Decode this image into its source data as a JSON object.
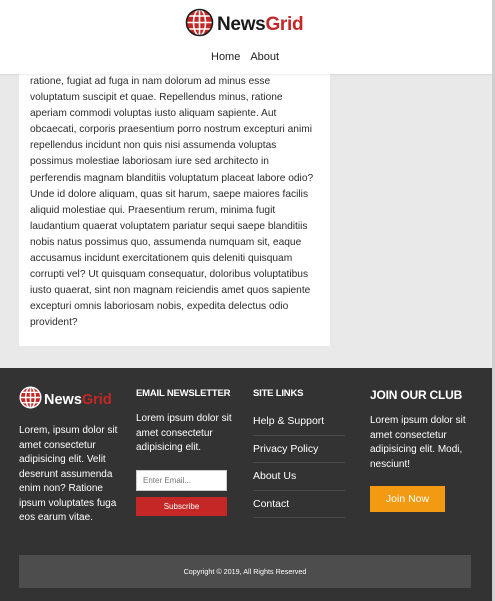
{
  "header": {
    "brand": {
      "part1": "News",
      "part2": "Grid",
      "logo_icon": "globe-icon"
    },
    "nav": [
      {
        "label": "Home"
      },
      {
        "label": "About"
      }
    ]
  },
  "article": {
    "body": "ratione, fugiat ad fuga in nam dolorum ad minus esse voluptatum suscipit et quae. Repellendus minus, ratione aperiam commodi voluptas iusto aliquam sapiente. Aut obcaecati, corporis praesentium porro nostrum excepturi animi repellendus incidunt non quis nisi assumenda voluptas possimus molestiae laboriosam iure sed architecto in perferendis magnam blanditiis voluptatum placeat labore odio? Unde id dolore aliquam, quas sit harum, saepe maiores facilis aliquid molestiae qui. Praesentium rerum, minima fugit laudantium quaerat voluptatem pariatur sequi saepe blanditiis nobis natus possimus quo, assumenda numquam sit, eaque accusamus incidunt exercitationem quis deleniti quisquam corrupti vel? Ut quisquam consequatur, doloribus voluptatibus iusto quaerat, sint non magnam reiciendis amet quos sapiente excepturi omnis laboriosam nobis, expedita delectus odio provident?"
  },
  "footer": {
    "about": {
      "brand_part1": "News",
      "brand_part2": "Grid",
      "text": "Lorem, ipsum dolor sit amet consectetur adipisicing elit. Velit deserunt assumenda enim non? Ratione ipsum voluptates fuga eos earum vitae."
    },
    "newsletter": {
      "heading": "Email Newsletter",
      "text": "Lorem ipsum dolor sit amet consectetur adipisicing elit.",
      "placeholder": "Enter Email...",
      "button": "Subscribe"
    },
    "links": {
      "heading": "Site Links",
      "items": [
        {
          "label": "Help & Support"
        },
        {
          "label": "Privacy Policy"
        },
        {
          "label": "About Us"
        },
        {
          "label": "Contact"
        }
      ]
    },
    "club": {
      "heading": "Join Our Club",
      "text": "Lorem ipsum dolor sit amet consectetur adipisicing elit. Modi, nesciunt!",
      "button": "Join Now"
    },
    "copyright": "Copyright © 2019, All Rights Reserved"
  },
  "colors": {
    "brand_red": "#c42726",
    "footer_bg": "#333333",
    "join_orange": "#f29a12"
  }
}
